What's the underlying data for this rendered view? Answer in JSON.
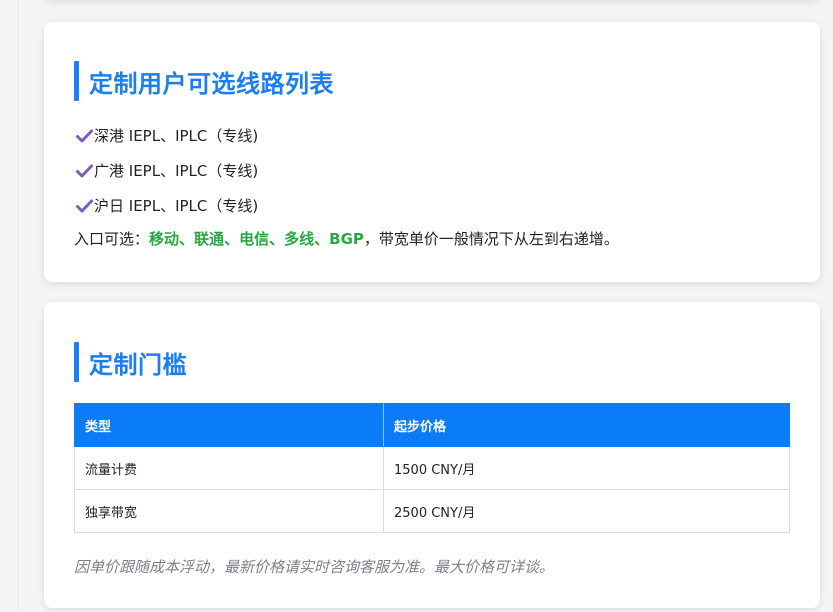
{
  "colors": {
    "accent": "#1a7ff5",
    "table_header": "#0a7cf8",
    "isp_green": "#28a745",
    "check_purple": "#7b5cc4",
    "note_gray": "#7b8089"
  },
  "routes_section": {
    "title": "定制用户可选线路列表",
    "items": [
      {
        "icon": "check-icon",
        "label": "深港 IEPL、IPLC（专线)"
      },
      {
        "icon": "check-icon",
        "label": "广港 IEPL、IPLC（专线)"
      },
      {
        "icon": "check-icon",
        "label": "沪日 IEPL、IPLC（专线)"
      }
    ],
    "entry": {
      "prefix": "入口可选：",
      "isps": [
        {
          "name": "移动",
          "sep": "、"
        },
        {
          "name": "联通",
          "sep": "、"
        },
        {
          "name": "电信",
          "sep": "、"
        },
        {
          "name": "多线",
          "sep": "、"
        },
        {
          "name": "BGP",
          "sep": ""
        }
      ],
      "suffix": "，带宽单价一般情况下从左到右递增。"
    }
  },
  "threshold_section": {
    "title": "定制门槛",
    "table": {
      "headers": [
        "类型",
        "起步价格"
      ],
      "rows": [
        [
          "流量计费",
          "1500 CNY/月"
        ],
        [
          "独享带宽",
          "2500 CNY/月"
        ]
      ]
    },
    "note": "因单价跟随成本浮动，最新价格请实时咨询客服为准。最大价格可详谈。"
  }
}
